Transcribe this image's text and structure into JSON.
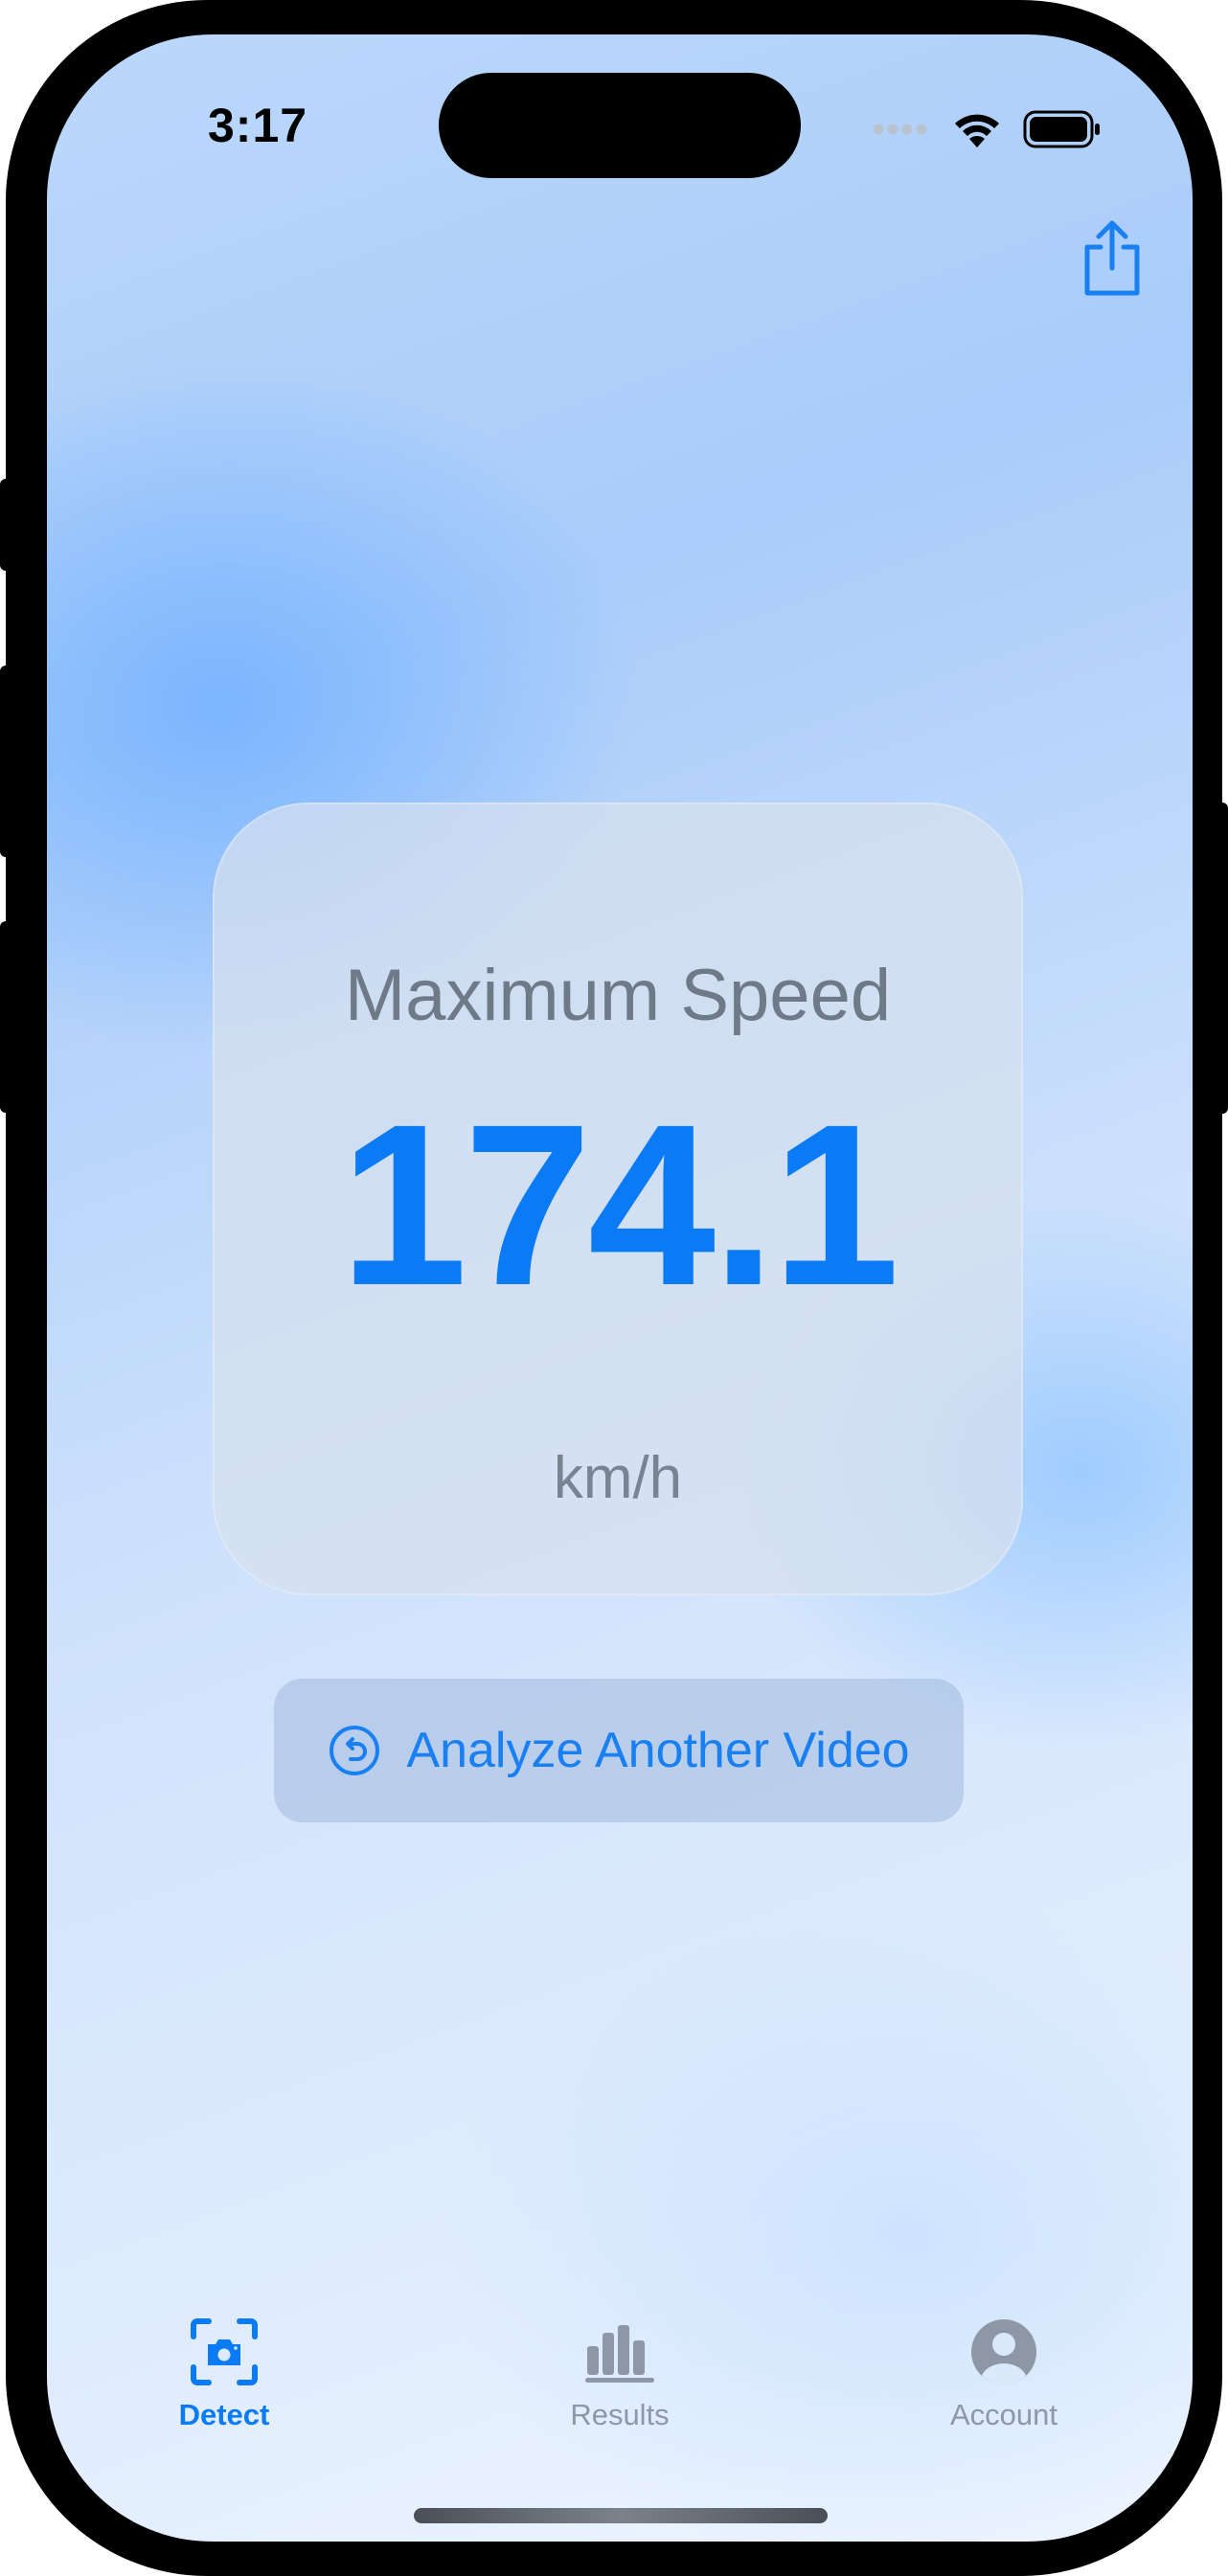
{
  "status_bar": {
    "time": "3:17"
  },
  "header": {
    "share_icon": "share-icon"
  },
  "result_card": {
    "title": "Maximum Speed",
    "value": "174.1",
    "unit": "km/h"
  },
  "actions": {
    "analyze_label": "Analyze Another Video",
    "analyze_icon": "reset-arrow-icon"
  },
  "tab_bar": {
    "tabs": [
      {
        "label": "Detect",
        "icon": "camera-viewfinder-icon",
        "active": true
      },
      {
        "label": "Results",
        "icon": "bar-chart-icon",
        "active": false
      },
      {
        "label": "Account",
        "icon": "person-circle-icon",
        "active": false
      }
    ]
  },
  "colors": {
    "accent": "#0A7AF5",
    "inactive": "#8E97A6",
    "card_title": "#6F7A88"
  }
}
